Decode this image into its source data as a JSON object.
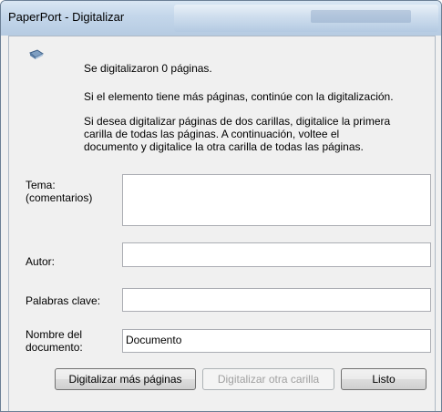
{
  "window": {
    "title": "PaperPort - Digitalizar"
  },
  "messages": {
    "scanned": "Se digitalizaron 0 páginas.",
    "more_pages": "Si el elemento tiene más páginas, continúe con la digitalización.",
    "duplex_line1": "Si desea digitalizar páginas de dos carillas, digitalice la primera",
    "duplex_line2": "carilla de todas las páginas. A continuación, voltee el",
    "duplex_line3": "documento y digitalice la otra carilla de todas las páginas."
  },
  "form": {
    "tema_label_line1": "Tema:",
    "tema_label_line2": "(comentarios)",
    "tema_value": "",
    "autor_label": "Autor:",
    "autor_value": "",
    "keywords_label": "Palabras clave:",
    "keywords_value": "",
    "docname_label_line1": "Nombre del",
    "docname_label_line2": "documento:",
    "docname_value": "Documento"
  },
  "buttons": {
    "scan_more": "Digitalizar más páginas",
    "scan_other_side": "Digitalizar otra carilla",
    "done": "Listo"
  },
  "icons": {
    "scan": "scanner-icon"
  }
}
